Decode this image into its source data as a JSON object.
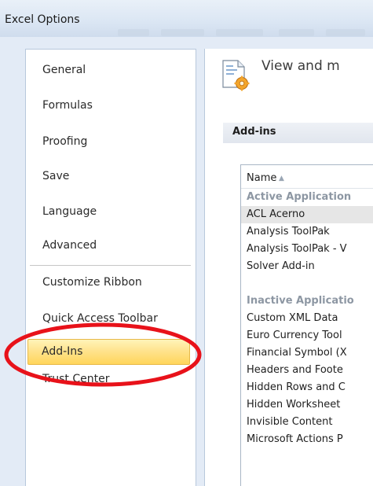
{
  "window": {
    "title": "Excel Options"
  },
  "colors": {
    "highlight_ellipse": "#e8121a",
    "selected_item": "#ffd55b",
    "accent_border": "#e7b94a"
  },
  "nav": {
    "items": [
      {
        "label": "General"
      },
      {
        "label": "Formulas"
      },
      {
        "label": "Proofing"
      },
      {
        "label": "Save"
      },
      {
        "label": "Language"
      },
      {
        "label": "Advanced"
      },
      {
        "label": "Customize Ribbon"
      },
      {
        "label": "Quick Access Toolbar"
      },
      {
        "label": "Add-Ins",
        "selected": true
      },
      {
        "label": "Trust Center"
      }
    ]
  },
  "content": {
    "header_text": "View and m",
    "header_icon": "addins-gear-icon",
    "section_title": "Add-ins",
    "list": {
      "column_name": "Name",
      "sort_icon": "sort-ascending-icon",
      "rows": [
        {
          "text": "Active Application",
          "type": "group"
        },
        {
          "text": "ACL Acerno",
          "type": "item",
          "selected": true
        },
        {
          "text": "Analysis ToolPak",
          "type": "item"
        },
        {
          "text": "Analysis ToolPak - V",
          "type": "item"
        },
        {
          "text": "Solver Add-in",
          "type": "item"
        },
        {
          "text": "",
          "type": "blank"
        },
        {
          "text": "Inactive Applicatio",
          "type": "group"
        },
        {
          "text": "Custom XML Data",
          "type": "item"
        },
        {
          "text": "Euro Currency Tool",
          "type": "item"
        },
        {
          "text": "Financial Symbol (X",
          "type": "item"
        },
        {
          "text": "Headers and Foote",
          "type": "item"
        },
        {
          "text": "Hidden Rows and C",
          "type": "item"
        },
        {
          "text": "Hidden Worksheet",
          "type": "item"
        },
        {
          "text": "Invisible Content",
          "type": "item"
        },
        {
          "text": "Microsoft Actions P",
          "type": "item"
        }
      ]
    }
  }
}
